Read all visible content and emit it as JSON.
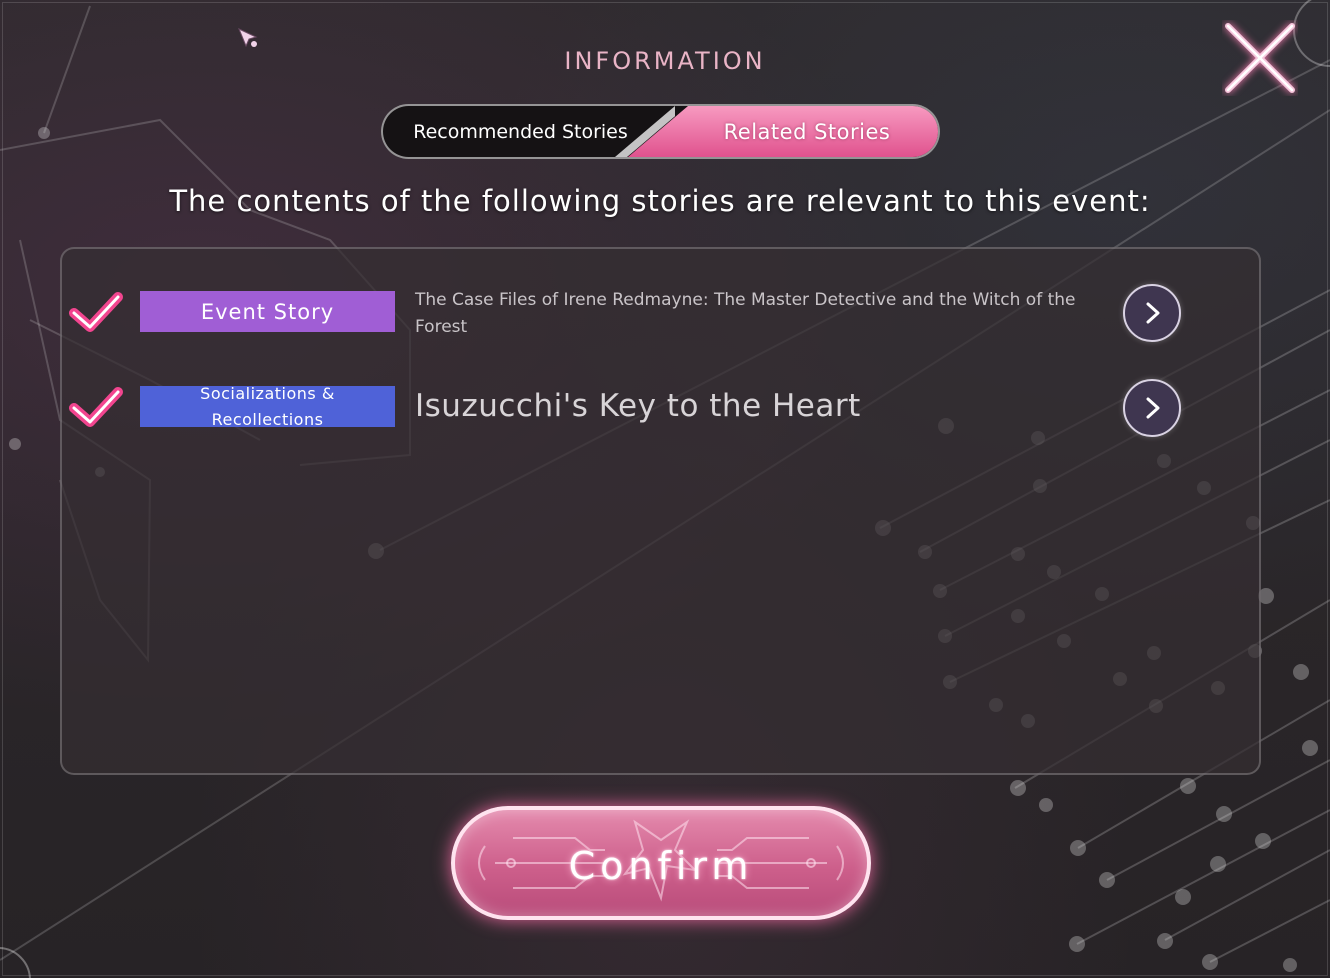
{
  "dialog": {
    "title": "INFORMATION",
    "close_icon": "close-x-icon"
  },
  "tabs": [
    {
      "label": "Recommended Stories",
      "active": false
    },
    {
      "label": "Related Stories",
      "active": true
    }
  ],
  "subtitle": "The contents of the following stories are relevant to this event:",
  "stories": [
    {
      "checked": true,
      "category": "Event Story",
      "category_color": "#a05ed5",
      "title": "The Case Files of Irene Redmayne: The Master Detective and the Witch of the Forest",
      "icon": "chevron-right-icon"
    },
    {
      "checked": true,
      "category": "Socializations & Recollections",
      "category_color": "#4f62d8",
      "title": "Isuzucchi's Key to the Heart",
      "icon": "chevron-right-icon"
    }
  ],
  "confirm_label": "Confirm",
  "colors": {
    "accent_pink": "#e0528e",
    "check_pink": "#f2458f",
    "background": "#2b2629"
  }
}
